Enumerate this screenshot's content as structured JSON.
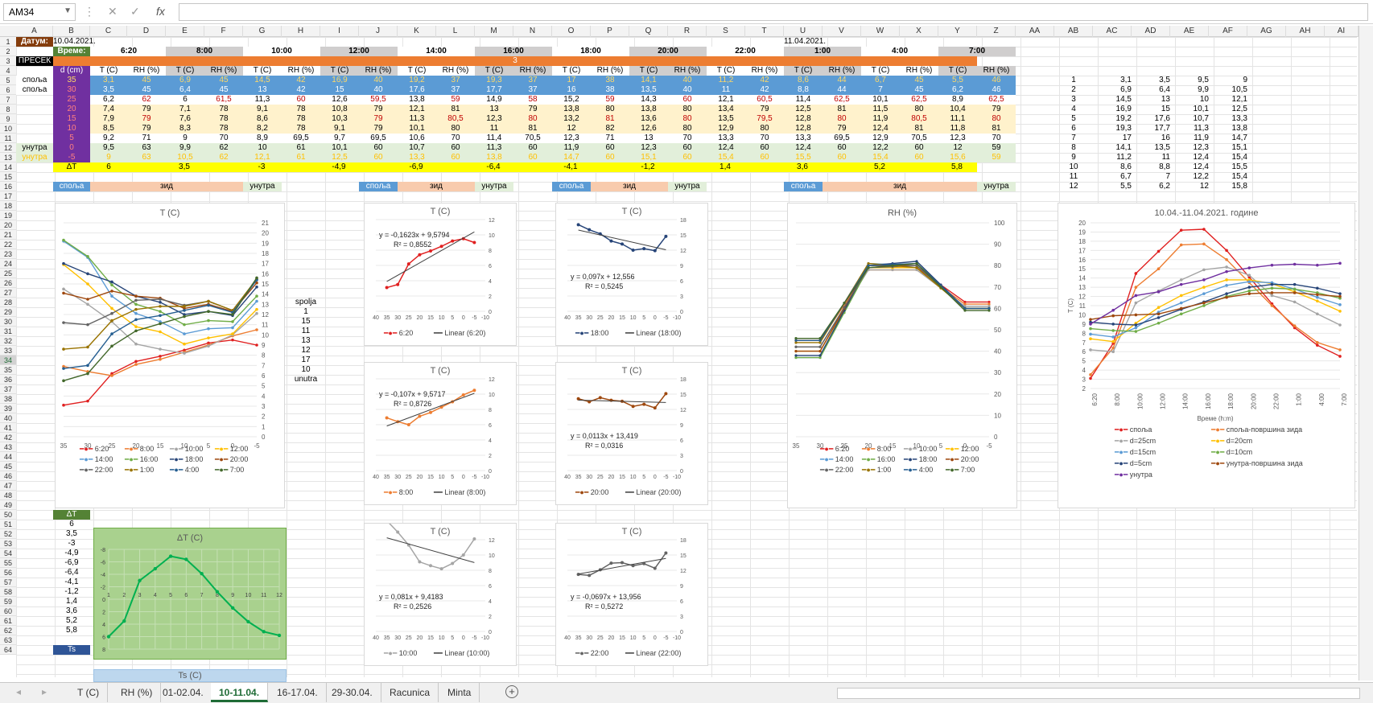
{
  "namebox": "AM34",
  "formula_value": "",
  "columns": [
    "A",
    "B",
    "C",
    "D",
    "E",
    "F",
    "G",
    "H",
    "I",
    "J",
    "K",
    "L",
    "M",
    "N",
    "O",
    "P",
    "Q",
    "R",
    "S",
    "T",
    "U",
    "V",
    "W",
    "X",
    "Y",
    "Z",
    "AA",
    "AB",
    "AC",
    "AD",
    "AE",
    "AF",
    "AG",
    "AH",
    "AI"
  ],
  "rows": [
    "1",
    "2",
    "3",
    "4",
    "5",
    "6",
    "7",
    "8",
    "9",
    "10",
    "11",
    "12",
    "13",
    "14",
    "15",
    "16",
    "17",
    "18",
    "19",
    "20",
    "21",
    "22",
    "23",
    "24",
    "25",
    "26",
    "27",
    "28",
    "29",
    "30",
    "31",
    "32",
    "33",
    "34",
    "35",
    "36",
    "37",
    "38",
    "39",
    "40",
    "41",
    "42",
    "43",
    "44",
    "45",
    "46",
    "47",
    "48",
    "49",
    "50",
    "51",
    "52",
    "53",
    "54",
    "55",
    "56",
    "57",
    "58",
    "59",
    "60",
    "61",
    "62",
    "63",
    "64"
  ],
  "header": {
    "datum_label": "Датум:",
    "datum1": "10.04.2021.",
    "datum2": "11.04.2021.",
    "vreme_label": "Време:",
    "times": [
      "6:20",
      "8:00",
      "10:00",
      "12:00",
      "14:00",
      "16:00",
      "18:00",
      "20:00",
      "22:00",
      "1:00",
      "4:00",
      "7:00"
    ],
    "presek_label": "ПРЕСЕК",
    "presek_value": "3",
    "d_label": "d (cm)",
    "t_col": "T (C)",
    "rh_col": "RH (%)"
  },
  "table_rows": [
    {
      "label": "спољa",
      "d": "35",
      "vals": [
        "3,1",
        "45",
        "6,9",
        "45",
        "14,5",
        "42",
        "16,9",
        "40",
        "19,2",
        "37",
        "19,3",
        "37",
        "17",
        "38",
        "14,1",
        "40",
        "11,2",
        "42",
        "8,6",
        "44",
        "6,7",
        "45",
        "5,5",
        "46"
      ]
    },
    {
      "label": "спољa",
      "d": "30",
      "vals": [
        "3,5",
        "45",
        "6,4",
        "45",
        "13",
        "42",
        "15",
        "40",
        "17,6",
        "37",
        "17,7",
        "37",
        "16",
        "38",
        "13,5",
        "40",
        "11",
        "42",
        "8,8",
        "44",
        "7",
        "45",
        "6,2",
        "46"
      ]
    },
    {
      "label": "",
      "d": "25",
      "vals": [
        "6,2",
        "62",
        "6",
        "61,5",
        "11,3",
        "60",
        "12,6",
        "59,5",
        "13,8",
        "59",
        "14,9",
        "58",
        "15,2",
        "59",
        "14,3",
        "60",
        "12,1",
        "60,5",
        "11,4",
        "62,5",
        "10,1",
        "62,5",
        "8,9",
        "62,5"
      ]
    },
    {
      "label": "",
      "d": "20",
      "vals": [
        "7,4",
        "79",
        "7,1",
        "78",
        "9,1",
        "78",
        "10,8",
        "79",
        "12,1",
        "81",
        "13",
        "79",
        "13,8",
        "80",
        "13,8",
        "80",
        "13,4",
        "79",
        "12,5",
        "81",
        "11,5",
        "80",
        "10,4",
        "79"
      ]
    },
    {
      "label": "",
      "d": "15",
      "vals": [
        "7,9",
        "79",
        "7,6",
        "78",
        "8,6",
        "78",
        "10,3",
        "79",
        "11,3",
        "80,5",
        "12,3",
        "80",
        "13,2",
        "81",
        "13,6",
        "80",
        "13,5",
        "79,5",
        "12,8",
        "80",
        "11,9",
        "80,5",
        "11,1",
        "80"
      ]
    },
    {
      "label": "",
      "d": "10",
      "vals": [
        "8,5",
        "79",
        "8,3",
        "78",
        "8,2",
        "78",
        "9,1",
        "79",
        "10,1",
        "80",
        "11",
        "81",
        "12",
        "82",
        "12,6",
        "80",
        "12,9",
        "80",
        "12,8",
        "79",
        "12,4",
        "81",
        "11,8",
        "81"
      ]
    },
    {
      "label": "",
      "d": "5",
      "vals": [
        "9,2",
        "71",
        "9",
        "70",
        "8,9",
        "69,5",
        "9,7",
        "69,5",
        "10,6",
        "70",
        "11,4",
        "70,5",
        "12,3",
        "71",
        "13",
        "70",
        "13,3",
        "70",
        "13,3",
        "69,5",
        "12,9",
        "70,5",
        "12,3",
        "70"
      ]
    },
    {
      "label": "унутра",
      "d": "0",
      "vals": [
        "9,5",
        "63",
        "9,9",
        "62",
        "10",
        "61",
        "10,1",
        "60",
        "10,7",
        "60",
        "11,3",
        "60",
        "11,9",
        "60",
        "12,3",
        "60",
        "12,4",
        "60",
        "12,4",
        "60",
        "12,2",
        "60",
        "12",
        "59"
      ]
    },
    {
      "label": "унутра",
      "d": "-5",
      "vals": [
        "9",
        "63",
        "10,5",
        "62",
        "12,1",
        "61",
        "12,5",
        "60",
        "13,3",
        "60",
        "13,8",
        "60",
        "14,7",
        "60",
        "15,1",
        "60",
        "15,4",
        "60",
        "15,5",
        "60",
        "15,4",
        "60",
        "15,6",
        "59"
      ]
    }
  ],
  "delta_row": {
    "label": "ΔT",
    "vals": [
      "6",
      "3,5",
      "-3",
      "-4,9",
      "-6,9",
      "-6,4",
      "-4,1",
      "-1,2",
      "1,4",
      "3,6",
      "5,2",
      "5,8"
    ]
  },
  "zone_labels": {
    "out": "спољa",
    "wall": "зид",
    "in": "унутра"
  },
  "side_list": [
    "spolja",
    "1",
    "15",
    "11",
    "13",
    "12",
    "17",
    "10",
    "unutra"
  ],
  "right_table": [
    [
      "1",
      "3,1",
      "3,5",
      "9,5",
      "9"
    ],
    [
      "2",
      "6,9",
      "6,4",
      "9,9",
      "10,5"
    ],
    [
      "3",
      "14,5",
      "13",
      "10",
      "12,1"
    ],
    [
      "4",
      "16,9",
      "15",
      "10,1",
      "12,5"
    ],
    [
      "5",
      "19,2",
      "17,6",
      "10,7",
      "13,3"
    ],
    [
      "6",
      "19,3",
      "17,7",
      "11,3",
      "13,8"
    ],
    [
      "7",
      "17",
      "16",
      "11,9",
      "14,7"
    ],
    [
      "8",
      "14,1",
      "13,5",
      "12,3",
      "15,1"
    ],
    [
      "9",
      "11,2",
      "11",
      "12,4",
      "15,4"
    ],
    [
      "10",
      "8,6",
      "8,8",
      "12,4",
      "15,5"
    ],
    [
      "11",
      "6,7",
      "7",
      "12,2",
      "15,4"
    ],
    [
      "12",
      "5,5",
      "6,2",
      "12",
      "15,8"
    ]
  ],
  "dt_table": {
    "header": "ΔT",
    "vals": [
      "6",
      "3,5",
      "-3",
      "-4,9",
      "-6,9",
      "-6,4",
      "-4,1",
      "-1,2",
      "1,4",
      "3,6",
      "5,2",
      "5,8"
    ]
  },
  "ts_label": "Ts",
  "ts_chart_title": "Ts (C)",
  "colors": {
    "green_hdr": "#70ad47",
    "orange": "#ed7d31",
    "blue": "#5b9bd5",
    "purple": "#7030a0",
    "yellow": "#ffff00",
    "peach": "#fbe5d6"
  },
  "tabs": [
    "T (C)",
    "RH (%)",
    "01-02.04.",
    "10-11.04.",
    "16-17.04.",
    "29-30.04.",
    "Racunica",
    "Minta"
  ],
  "active_tab": "10-11.04.",
  "chart_data": [
    {
      "type": "line",
      "title": "T (C)",
      "x": [
        35,
        30,
        25,
        20,
        15,
        10,
        5,
        0,
        -5
      ],
      "ylim": [
        0,
        21
      ],
      "series": [
        {
          "name": "6:20",
          "values": [
            3.1,
            3.5,
            6.2,
            7.4,
            7.9,
            8.5,
            9.2,
            9.5,
            9
          ]
        },
        {
          "name": "8:00",
          "values": [
            6.9,
            6.4,
            6,
            7.1,
            7.6,
            8.3,
            9,
            9.9,
            10.5
          ]
        },
        {
          "name": "10:00",
          "values": [
            14.5,
            13,
            11.3,
            9.1,
            8.6,
            8.2,
            8.9,
            10,
            12.1
          ]
        },
        {
          "name": "12:00",
          "values": [
            16.9,
            15,
            12.6,
            10.8,
            10.3,
            9.1,
            9.7,
            10.1,
            12.5
          ]
        },
        {
          "name": "14:00",
          "values": [
            19.2,
            17.6,
            13.8,
            12.1,
            11.3,
            10.1,
            10.6,
            10.7,
            13.3
          ]
        },
        {
          "name": "16:00",
          "values": [
            19.3,
            17.7,
            14.9,
            13,
            12.3,
            11,
            11.4,
            11.3,
            13.8
          ]
        },
        {
          "name": "18:00",
          "values": [
            17,
            16,
            15.2,
            13.8,
            13.2,
            12,
            12.3,
            11.9,
            14.7
          ]
        },
        {
          "name": "20:00",
          "values": [
            14.1,
            13.5,
            14.3,
            13.8,
            13.6,
            12.6,
            13,
            12.3,
            15.1
          ]
        },
        {
          "name": "22:00",
          "values": [
            11.2,
            11,
            12.1,
            13.4,
            13.5,
            12.9,
            13.3,
            12.4,
            15.4
          ]
        },
        {
          "name": "1:00",
          "values": [
            8.6,
            8.8,
            11.4,
            12.5,
            12.8,
            12.8,
            13.3,
            12.4,
            15.5
          ]
        },
        {
          "name": "4:00",
          "values": [
            6.7,
            7,
            10.1,
            11.5,
            11.9,
            12.4,
            12.9,
            12.2,
            15.4
          ]
        },
        {
          "name": "7:00",
          "values": [
            5.5,
            6.2,
            8.9,
            10.4,
            11.1,
            11.8,
            12.3,
            12,
            15.6
          ]
        }
      ]
    },
    {
      "type": "scatter",
      "title": "T (C)",
      "equation": "y = -0,1623x + 9,5794",
      "r2": "R² = 0,8552",
      "series_name": "6:20",
      "trend_name": "Linear (6:20)"
    },
    {
      "type": "scatter",
      "title": "T (C)",
      "equation": "y = 0,097x + 12,556",
      "r2": "R² = 0,5245",
      "series_name": "18:00",
      "trend_name": "Linear (18:00)"
    },
    {
      "type": "scatter",
      "title": "T (C)",
      "equation": "y = -0,107x + 9,5717",
      "r2": "R² = 0,8726",
      "series_name": "8:00",
      "trend_name": "Linear (8:00)"
    },
    {
      "type": "scatter",
      "title": "T (C)",
      "equation": "y = 0,0113x + 13,419",
      "r2": "R² = 0,0316",
      "series_name": "20:00",
      "trend_name": "Linear (20:00)"
    },
    {
      "type": "scatter",
      "title": "T (C)",
      "equation": "y = 0,081x + 9,4183",
      "r2": "R² = 0,2526",
      "series_name": "10:00",
      "trend_name": "Linear (10:00)"
    },
    {
      "type": "scatter",
      "title": "T (C)",
      "equation": "y = -0,0697x + 13,956",
      "r2": "R² = 0,5272",
      "series_name": "22:00",
      "trend_name": "Linear (22:00)"
    },
    {
      "type": "line",
      "title": "RH (%)",
      "x": [
        35,
        30,
        25,
        20,
        15,
        10,
        5,
        0,
        -5
      ],
      "ylim": [
        0,
        100
      ]
    },
    {
      "type": "line",
      "title": "10.04.-11.04.2021. године",
      "ylabel": "T (C)",
      "xlabel": "Време (h:m)",
      "x": [
        "6:20",
        "8:00",
        "10:00",
        "12:00",
        "14:00",
        "16:00",
        "18:00",
        "20:00",
        "22:00",
        "1:00",
        "4:00",
        "7:00"
      ],
      "ylim": [
        2,
        20
      ],
      "series_names": [
        "спољa",
        "спољa-површина зида",
        "d=25cm",
        "d=20cm",
        "d=15cm",
        "d=10cm",
        "d=5cm",
        "унутра-површина зида",
        "унутра"
      ]
    },
    {
      "type": "line",
      "title": "ΔT (C)",
      "x": [
        1,
        2,
        3,
        4,
        5,
        6,
        7,
        8,
        9,
        10,
        11,
        12
      ],
      "values": [
        6,
        3.5,
        -3,
        -4.9,
        -6.9,
        -6.4,
        -4.1,
        -1.2,
        1.4,
        3.6,
        5.2,
        5.8
      ],
      "ylim": [
        -8,
        8
      ]
    }
  ]
}
